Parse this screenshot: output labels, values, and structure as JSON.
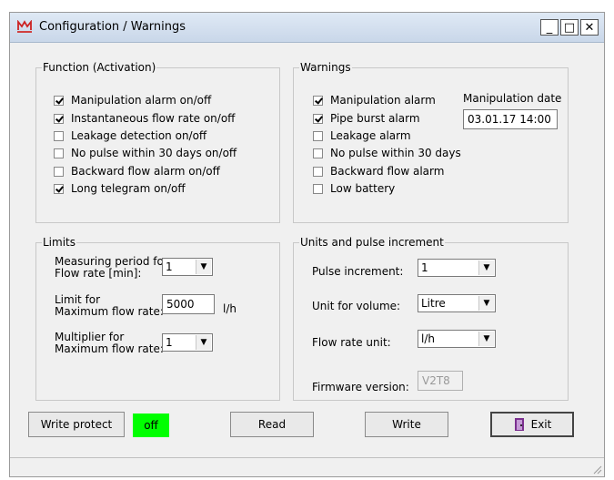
{
  "window": {
    "title": "Configuration / Warnings",
    "minimize_label": "_",
    "maximize_label": "□",
    "close_label": "✕"
  },
  "function_group": {
    "legend": "Function (Activation)",
    "items": [
      {
        "label": "Manipulation alarm on/off",
        "checked": true
      },
      {
        "label": "Instantaneous flow rate on/off",
        "checked": true
      },
      {
        "label": "Leakage detection on/off",
        "checked": false
      },
      {
        "label": "No pulse within 30 days on/off",
        "checked": false
      },
      {
        "label": "Backward flow alarm on/off",
        "checked": false
      },
      {
        "label": "Long telegram on/off",
        "checked": true
      }
    ]
  },
  "warnings_group": {
    "legend": "Warnings",
    "items": [
      {
        "label": "Manipulation alarm",
        "checked": true
      },
      {
        "label": "Pipe burst alarm",
        "checked": true
      },
      {
        "label": "Leakage alarm",
        "checked": false
      },
      {
        "label": "No pulse within 30 days",
        "checked": false
      },
      {
        "label": "Backward flow alarm",
        "checked": false
      },
      {
        "label": "Low battery",
        "checked": false
      }
    ],
    "manipulation_date_label": "Manipulation date",
    "manipulation_date_value": "03.01.17 14:00"
  },
  "limits_group": {
    "legend": "Limits",
    "measuring_period_label_1": "Measuring period for",
    "measuring_period_label_2": "Flow rate [min]:",
    "measuring_period_value": "1",
    "limit_label_1": "Limit for",
    "limit_label_2": "Maximum flow rate:",
    "limit_value": "5000",
    "limit_unit": "l/h",
    "multiplier_label_1": "Multiplier for",
    "multiplier_label_2": "Maximum flow rate:",
    "multiplier_value": "1"
  },
  "units_group": {
    "legend": "Units and pulse increment",
    "pulse_increment_label": "Pulse increment:",
    "pulse_increment_value": "1",
    "unit_volume_label": "Unit for volume:",
    "unit_volume_value": "Litre",
    "flow_rate_unit_label": "Flow rate unit:",
    "flow_rate_unit_value": "l/h",
    "firmware_label": "Firmware version:",
    "firmware_value": "V2T8"
  },
  "buttons": {
    "write_protect": "Write protect",
    "write_protect_state": "off",
    "read": "Read",
    "write": "Write",
    "exit": "Exit"
  },
  "colors": {
    "write_protect_state_bg": "#00ff00"
  }
}
